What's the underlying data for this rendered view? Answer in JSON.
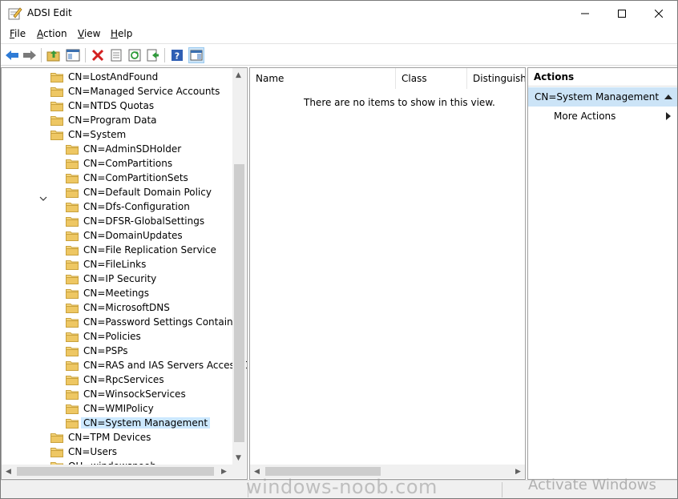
{
  "window": {
    "title": "ADSI Edit"
  },
  "menu": [
    {
      "key": "F",
      "rest": "ile"
    },
    {
      "key": "A",
      "rest": "ction"
    },
    {
      "key": "V",
      "rest": "iew"
    },
    {
      "key": "H",
      "rest": "elp"
    }
  ],
  "tree": {
    "items": [
      {
        "label": "CN=LostAndFound",
        "level": 1
      },
      {
        "label": "CN=Managed Service Accounts",
        "level": 1
      },
      {
        "label": "CN=NTDS Quotas",
        "level": 1
      },
      {
        "label": "CN=Program Data",
        "level": 1
      },
      {
        "label": "CN=System",
        "level": 1,
        "expanded": true
      },
      {
        "label": "CN=AdminSDHolder",
        "level": 2
      },
      {
        "label": "CN=ComPartitions",
        "level": 2
      },
      {
        "label": "CN=ComPartitionSets",
        "level": 2
      },
      {
        "label": "CN=Default Domain Policy",
        "level": 2
      },
      {
        "label": "CN=Dfs-Configuration",
        "level": 2
      },
      {
        "label": "CN=DFSR-GlobalSettings",
        "level": 2
      },
      {
        "label": "CN=DomainUpdates",
        "level": 2
      },
      {
        "label": "CN=File Replication Service",
        "level": 2
      },
      {
        "label": "CN=FileLinks",
        "level": 2
      },
      {
        "label": "CN=IP Security",
        "level": 2
      },
      {
        "label": "CN=Meetings",
        "level": 2
      },
      {
        "label": "CN=MicrosoftDNS",
        "level": 2
      },
      {
        "label": "CN=Password Settings Container",
        "level": 2
      },
      {
        "label": "CN=Policies",
        "level": 2
      },
      {
        "label": "CN=PSPs",
        "level": 2
      },
      {
        "label": "CN=RAS and IAS Servers Access Ch",
        "level": 2
      },
      {
        "label": "CN=RpcServices",
        "level": 2
      },
      {
        "label": "CN=WinsockServices",
        "level": 2
      },
      {
        "label": "CN=WMIPolicy",
        "level": 2
      },
      {
        "label": "CN=System Management",
        "level": 2,
        "selected": true
      },
      {
        "label": "CN=TPM Devices",
        "level": 1
      },
      {
        "label": "CN=Users",
        "level": 1
      },
      {
        "label": "OU=windowsnoob",
        "level": 1
      }
    ]
  },
  "list": {
    "columns": [
      "Name",
      "Class",
      "Distinguishe"
    ],
    "empty_message": "There are no items to show in this view."
  },
  "actions": {
    "title": "Actions",
    "group": "CN=System Management",
    "items": [
      "More Actions"
    ]
  },
  "overlay": {
    "watermark": "windows-noob.com",
    "activate": "Activate Windows"
  },
  "colors": {
    "selection": "#cce8ff",
    "action_group": "#cce4f7",
    "folder": "#e8c15a"
  }
}
